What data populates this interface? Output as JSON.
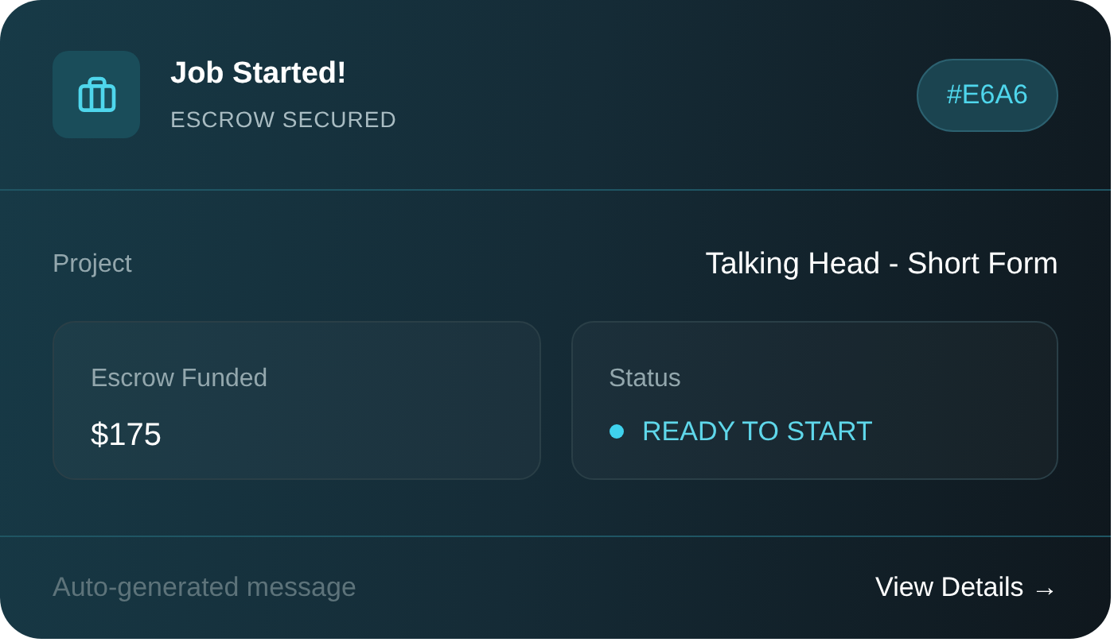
{
  "header": {
    "title": "Job Started!",
    "subtitle": "ESCROW SECURED",
    "code": "#E6A6"
  },
  "project": {
    "label": "Project",
    "value": "Talking Head - Short Form"
  },
  "stats": [
    {
      "kind": "amount",
      "label": "Escrow Funded",
      "value": "$175"
    },
    {
      "kind": "status",
      "label": "Status",
      "value": "READY TO START"
    }
  ],
  "footer": {
    "note": "Auto-generated message",
    "link": "View Details →"
  }
}
